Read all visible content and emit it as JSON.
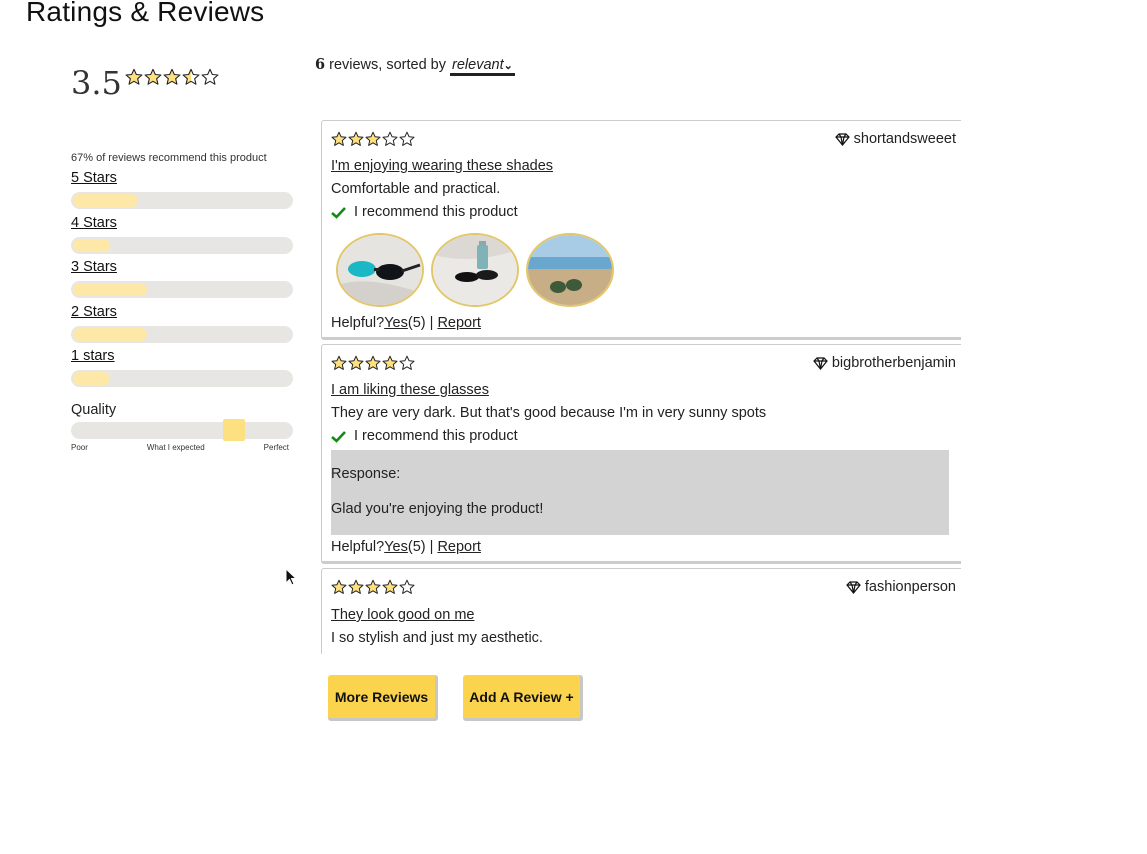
{
  "page_title": "Ratings & Reviews",
  "summary": {
    "average": "3.5",
    "average_stars": 3.5,
    "recommend_text": "67% of reviews recommend this product",
    "breakdown": [
      {
        "label": "5 Stars",
        "fraction": 0.3
      },
      {
        "label": "4 Stars",
        "fraction": 0.17
      },
      {
        "label": "3 Stars",
        "fraction": 0.34
      },
      {
        "label": "2 Stars",
        "fraction": 0.34
      },
      {
        "label": "1 stars",
        "fraction": 0.17
      }
    ],
    "quality": {
      "label": "Quality",
      "level": 0.76,
      "ticks": [
        "Poor",
        "What I expected",
        "Perfect"
      ]
    }
  },
  "sort": {
    "count": "6",
    "text": "reviews, sorted by",
    "selected": "relevant"
  },
  "reviews": [
    {
      "rating": 3,
      "user": "shortandsweeet",
      "title": "I'm enjoying wearing these shades",
      "body": "Comfortable and practical.",
      "recommend": "I recommend this product",
      "photos": [
        "sunglasses-on-sand",
        "sunglasses-and-bottle",
        "sunglasses-on-beach"
      ],
      "helpful": {
        "label": "Helpful?",
        "yes": "Yes",
        "count": "(5)",
        "sep": "|",
        "report": "Report"
      }
    },
    {
      "rating": 4,
      "user": "bigbrotherbenjamin",
      "title": "I am liking these glasses",
      "body": "They are very dark. But that's good because I'm in very sunny spots",
      "recommend": "I recommend this product",
      "response_label": "Response:",
      "response_text": "Glad you're enjoying the product!",
      "helpful": {
        "label": "Helpful?",
        "yes": "Yes",
        "count": "(5)",
        "sep": "|",
        "report": "Report"
      }
    },
    {
      "rating": 4,
      "user": "fashionperson",
      "title": "They look good on me",
      "body": "I so stylish and just my aesthetic."
    }
  ],
  "buttons": {
    "more_reviews": "More Reviews",
    "add_review": "Add A Review +"
  },
  "colors": {
    "star_fill": "#fde07f",
    "bar_fill": "#fde8a8",
    "button": "#fcd34d",
    "check": "#138a13",
    "response_bg": "#d3d3d3"
  }
}
